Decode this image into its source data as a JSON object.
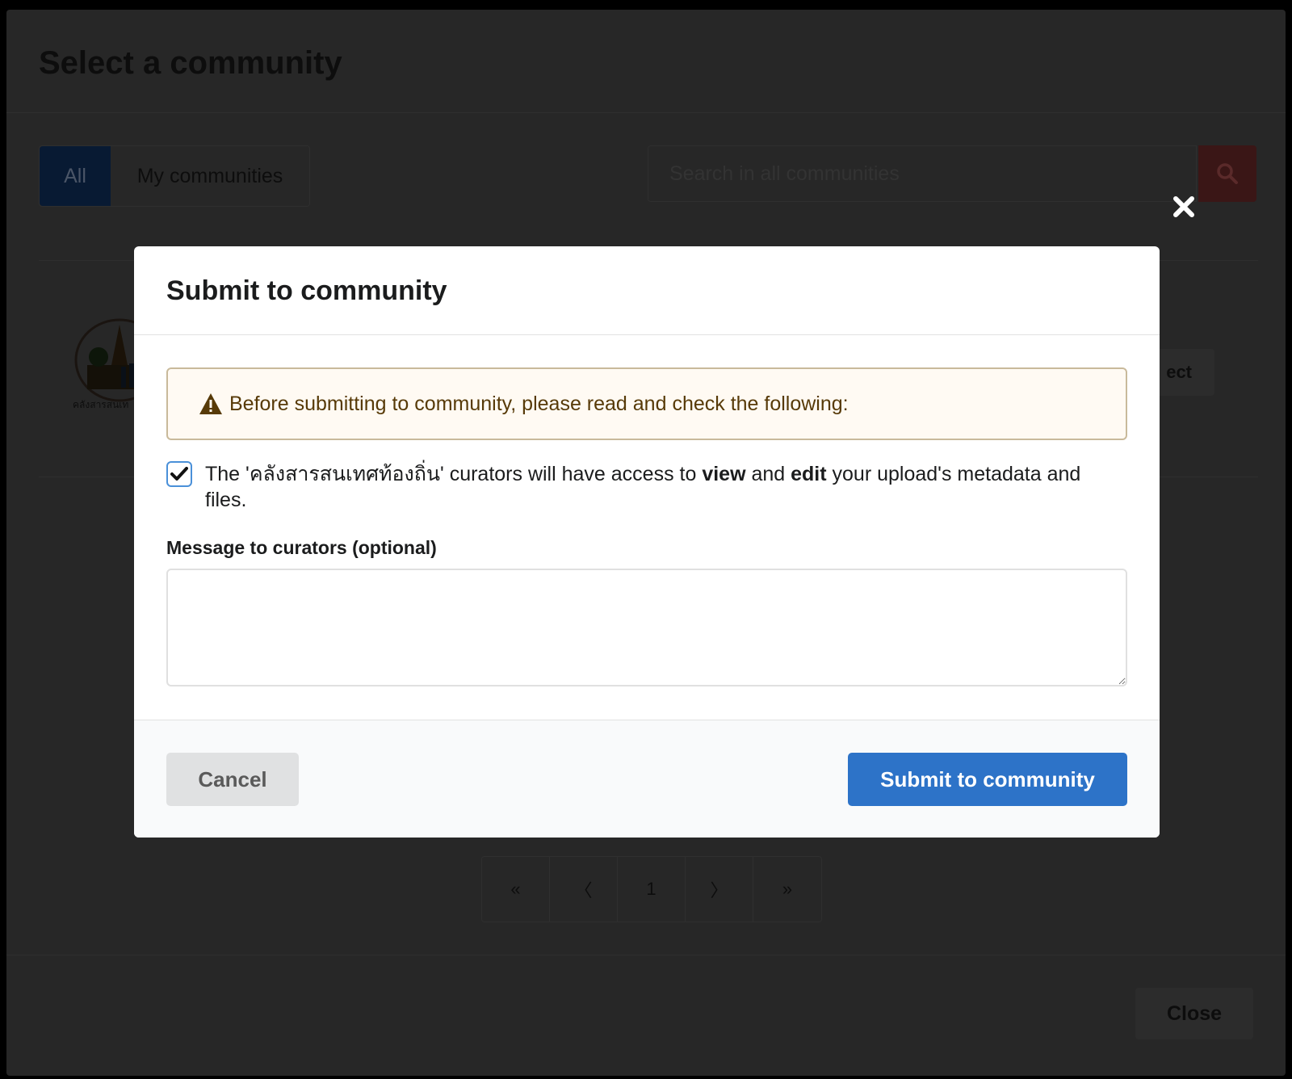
{
  "background_modal": {
    "title": "Select a community",
    "tabs": [
      {
        "label": "All",
        "active": true
      },
      {
        "label": "My communities",
        "active": false
      }
    ],
    "search": {
      "placeholder": "Search in all communities"
    },
    "community": {
      "logo_text": "คลังสารสนเท",
      "select_label": "ect"
    },
    "pagination": [
      "«",
      "〈",
      "1",
      "〉",
      "»"
    ],
    "close_label": "Close"
  },
  "modal": {
    "title": "Submit to community",
    "warning": "Before submitting to community, please read and check the following:",
    "agreement": {
      "checked": true,
      "prefix": "The '",
      "community_name": "คลังสารสนเทศท้องถิ่น",
      "middle_1": "' curators will have access to ",
      "view": "view",
      "middle_2": " and ",
      "edit": "edit",
      "suffix": " your upload's metadata and files."
    },
    "message_label": "Message to curators (optional)",
    "message_value": "",
    "cancel_label": "Cancel",
    "submit_label": "Submit to community"
  },
  "colors": {
    "submit_button": "#2d73c8",
    "cancel_button": "#e0e1e2",
    "warning_bg": "#fffaf3",
    "warning_text": "#573a08",
    "checkbox_border": "#4a90d9"
  },
  "icons": {
    "warning": "warning-triangle-icon",
    "check": "checkmark-icon",
    "close": "close-icon",
    "search": "search-icon"
  }
}
